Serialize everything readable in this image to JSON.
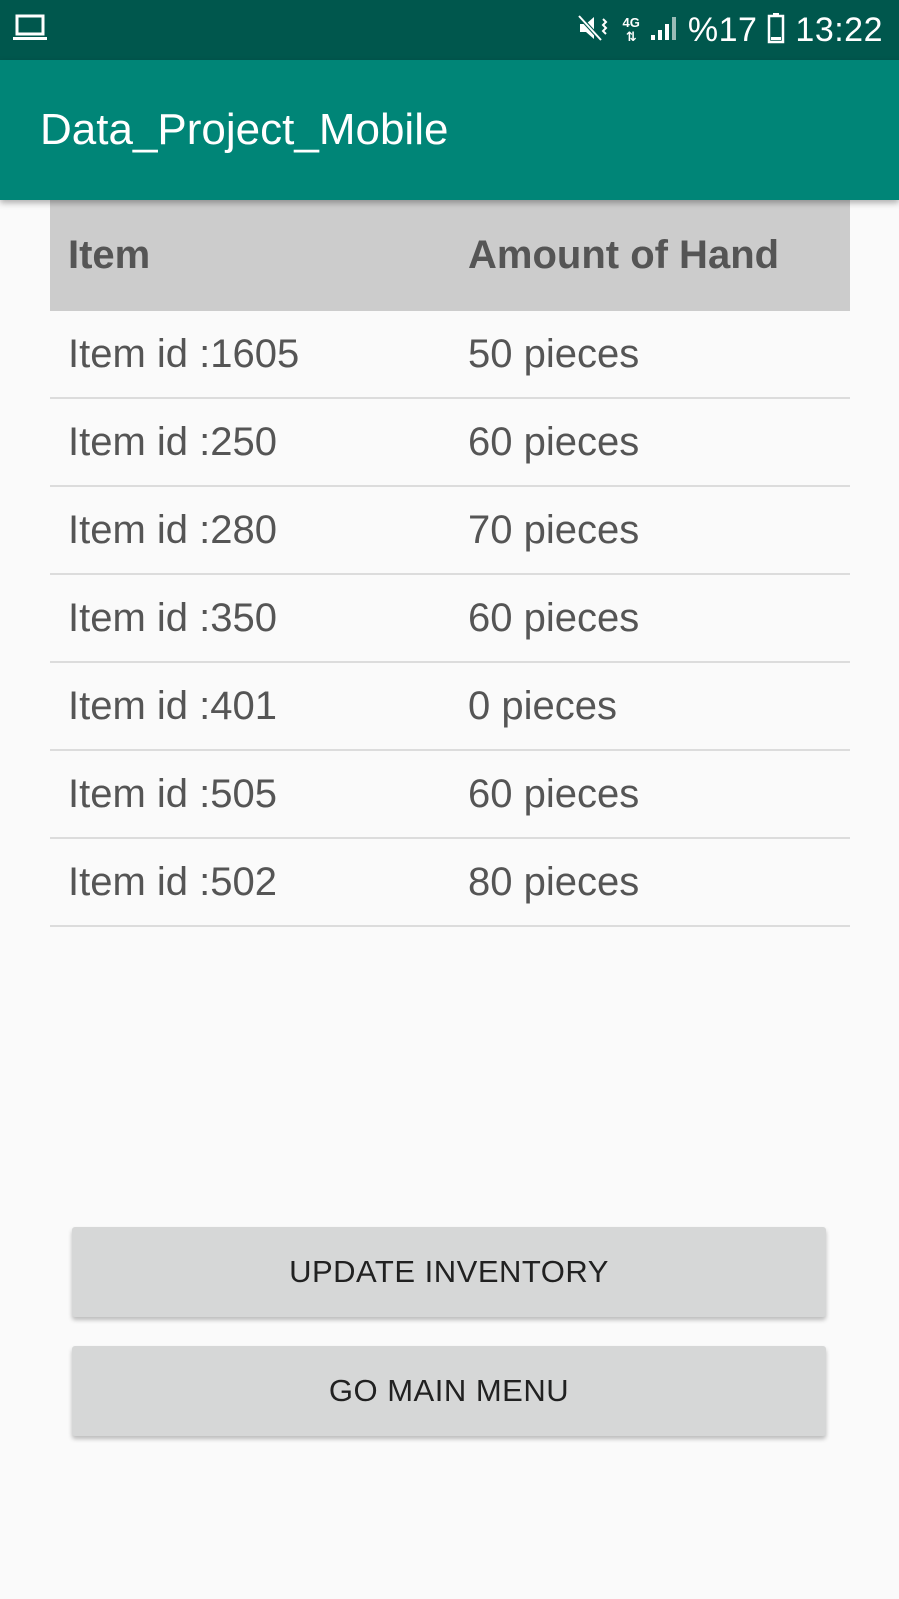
{
  "status_bar": {
    "network": "4G",
    "battery_text": "%17",
    "time": "13:22",
    "icons": {
      "left": "laptop-icon",
      "mute": "mute-vibrate-icon",
      "signal": "signal-icon",
      "battery": "battery-icon"
    }
  },
  "app_bar": {
    "title": "Data_Project_Mobile"
  },
  "table": {
    "headers": {
      "item": "Item",
      "amount": "Amount of Hand"
    },
    "rows": [
      {
        "item": "Item id :1605",
        "amount": "50 pieces"
      },
      {
        "item": "Item id :250",
        "amount": "60 pieces"
      },
      {
        "item": "Item id :280",
        "amount": "70 pieces"
      },
      {
        "item": "Item id :350",
        "amount": "60 pieces"
      },
      {
        "item": "Item id :401",
        "amount": "0 pieces"
      },
      {
        "item": "Item id :505",
        "amount": "60 pieces"
      },
      {
        "item": "Item id :502",
        "amount": "80 pieces"
      }
    ]
  },
  "buttons": {
    "update_label": "UPDATE INVENTORY",
    "main_menu_label": "GO MAIN MENU"
  },
  "colors": {
    "status_bar": "#00574d",
    "app_bar": "#008577",
    "header_row": "#cccccc",
    "button": "#d6d7d7"
  }
}
